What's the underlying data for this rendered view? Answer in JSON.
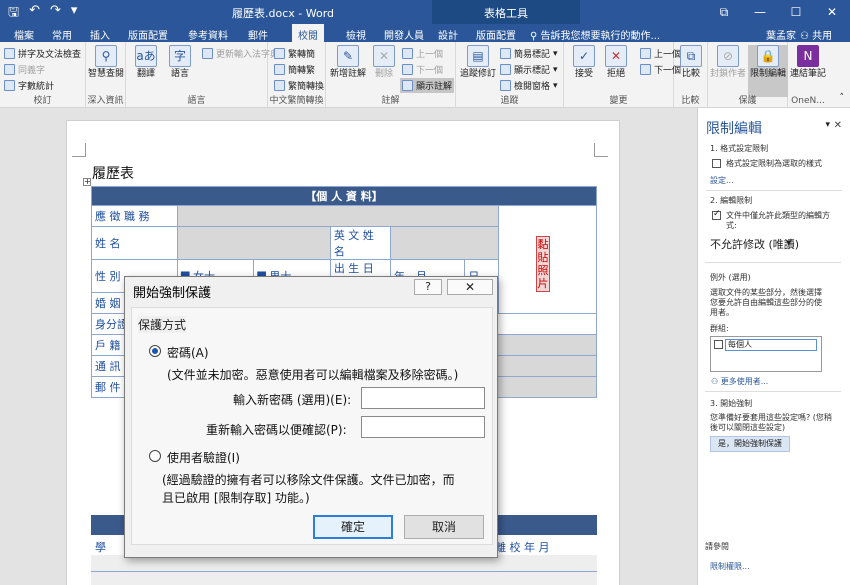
{
  "title_bar": {
    "doc_title": "履歷表.docx - Word",
    "table_tools": "表格工具",
    "qat": [
      "save-icon",
      "undo-icon",
      "redo-icon",
      "customize-icon"
    ],
    "min": "—",
    "restore": "☐",
    "close": "✕",
    "ribbon_opts": "⧉"
  },
  "tabs": [
    "檔案",
    "常用",
    "插入",
    "版面配置",
    "參考資料",
    "郵件",
    "校閱",
    "檢視",
    "開發人員",
    "設計",
    "版面配置"
  ],
  "active_tab": "校閱",
  "tell_me": "告訴我您想要執行的動作...",
  "user": "葉孟家",
  "share": "共用",
  "ribbon": {
    "proofing": {
      "label": "校訂",
      "items": [
        "拼字及文法檢查",
        "同義字",
        "字數統計"
      ]
    },
    "insights": {
      "label": "深入資訊",
      "smart": "智慧查閱"
    },
    "language": {
      "label": "語言",
      "translate": "翻譯",
      "lang": "語言",
      "update_ime": "更新輸入法字典"
    },
    "chinese": {
      "label": "中文繁簡轉換",
      "items": [
        "繁轉簡",
        "簡轉繁",
        "繁簡轉換"
      ]
    },
    "comments": {
      "label": "註解",
      "new": "新增註解",
      "delete": "刪除",
      "prev": "上一個",
      "next": "下一個",
      "show": "顯示註解"
    },
    "tracking": {
      "label": "追蹤",
      "track": "追蹤修訂",
      "simple": "簡易標記",
      "showmarkup": "顯示標記",
      "pane": "檢閱窗格"
    },
    "changes": {
      "label": "變更",
      "accept": "接受",
      "reject": "拒絕",
      "prev": "上一個",
      "next": "下一個"
    },
    "compare": {
      "label": "比較",
      "compare": "比較"
    },
    "protect": {
      "label": "保護",
      "block": "封鎖作者",
      "restrict": "限制編輯"
    },
    "onenote": {
      "label": "OneN...",
      "link": "連結筆記"
    }
  },
  "document": {
    "title": "履歷表",
    "header_row": "【個 人 資 料】",
    "rows": [
      "應 徵 職 務",
      "姓 名",
      "性 別",
      "婚 姻",
      "身分證",
      "戶 籍",
      "通 訊",
      "郵 件"
    ],
    "english_name": "英 文 姓 名",
    "female": "女士",
    "male": "男士",
    "birth": "出 生 日 期",
    "year": "年",
    "month": "月",
    "day": "日",
    "photo": "黏貼照片",
    "lower_labels": [
      "學",
      "離 校 年 月"
    ]
  },
  "dialog": {
    "title": "開始強制保護",
    "help": "?",
    "close": "✕",
    "section": "保護方式",
    "password_option": "密碼(A)",
    "password_desc": "(文件並未加密。惡意使用者可以編輯檔案及移除密碼。)",
    "new_password_label": "輸入新密碼 (選用)(E):",
    "confirm_password_label": "重新輸入密碼以便確認(P):",
    "user_auth_option": "使用者驗證(I)",
    "user_auth_desc_1": "(經過驗證的擁有者可以移除文件保護。文件已加密，而",
    "user_auth_desc_2": "且已啟用 [限制存取] 功能。)",
    "ok": "確定",
    "cancel": "取消"
  },
  "pane": {
    "title": "限制編輯",
    "close": "✕",
    "s1": "1. 格式設定限制",
    "s1_opt": "格式設定限制為選取的樣式",
    "s1_link": "設定...",
    "s2": "2. 編輯限制",
    "s2_opt_1": "文件中僅允許此類型的編輯方",
    "s2_opt_2": "式:",
    "s2_select": "不允許修改 (唯讀)",
    "exceptions": "例外 (選用)",
    "exc_desc_1": "選取文件的某些部分，然後選擇",
    "exc_desc_2": "您要允許自由編輯這些部分的使",
    "exc_desc_3": "用者。",
    "groups_label": "群組:",
    "group_item": "每個人",
    "more_users": "更多使用者...",
    "s3": "3. 開始強制",
    "s3_desc_1": "您準備好要套用這些設定嗎? (您稍",
    "s3_desc_2": "後可以關閉這些設定)",
    "start_btn": "是，開始強制保護",
    "see_also": "請參閱",
    "perm_link": "限制權限..."
  }
}
